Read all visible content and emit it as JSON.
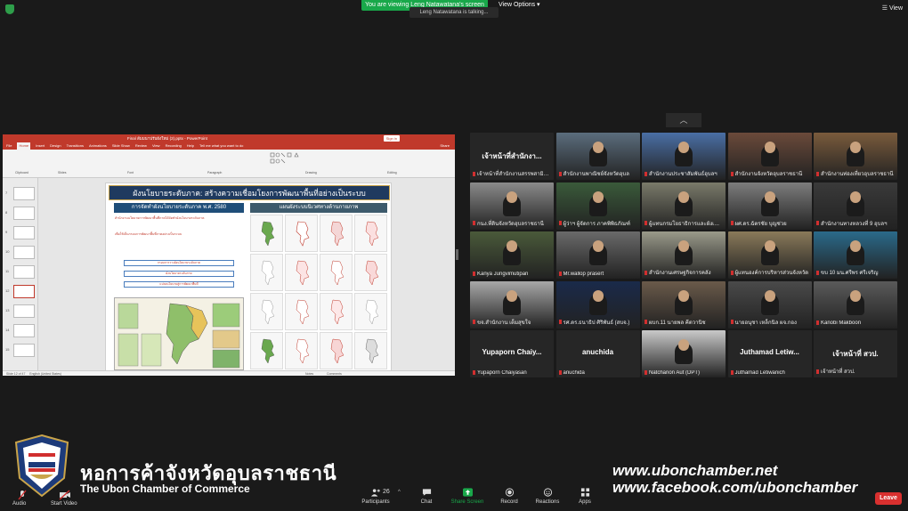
{
  "top": {
    "banner": "You are viewing Leng Natawatana's screen",
    "view_options": "View Options ▾",
    "talking": "Leng Natawatana is talking...",
    "view_button": "View"
  },
  "ppt": {
    "title": "Final สัมมนาปรับผังใหม่ (2).pptx - PowerPoint",
    "sign_in": "Sign in",
    "tabs": [
      "File",
      "Home",
      "Insert",
      "Design",
      "Transitions",
      "Animations",
      "Slide Show",
      "Review",
      "View",
      "Recording",
      "Help",
      "Tell me what you want to do"
    ],
    "share": "Share",
    "ribbon_groups": [
      "Clipboard",
      "Slides",
      "Font",
      "Paragraph",
      "Drawing",
      "Editing"
    ],
    "thumb_numbers": [
      "7",
      "8",
      "9",
      "10",
      "11",
      "12",
      "13",
      "14",
      "15"
    ],
    "status_left": "Slide 12 of 47",
    "status_lang": "English (United States)",
    "status_notes": "Notes",
    "status_comments": "Comments",
    "slide": {
      "title": "ผังนโยบายระดับภาค: สร้างความเชื่อมโยงการพัฒนาพื้นที่อย่างเป็นระบบ",
      "left_head": "การจัดทำผังนโยบายระดับภาค พ.ศ. 2580",
      "right_head": "แผนผังระบบนิเวศทางด้านกายภาพ",
      "bullet1": "สำนักงานนโยบายการพัฒนาพื้นที่ภาคได้จัดทำผังนโยบายระดับภาค",
      "bullet2": "เพื่อใช้เป็นกรอบการพัฒนาพื้นที่ภาคอย่างเป็นระบบ",
      "box1": "กรอบการวางผังนโยบายระดับภาค",
      "box2": "ผังนโยบายระดับภาค",
      "box3": "แปลงนโยบายสู่การพัฒนาพื้นที่"
    }
  },
  "gallery": [
    {
      "name": "เจ้าหน้าที่สำนักงา...",
      "label": "เจ้าหน้าที่สำนักงานสรรพสามิต...",
      "video": false
    },
    {
      "name": "",
      "label": "สำนักงานพาณิชย์จังหวัดอุบล",
      "video": true,
      "bg": "#5b6d7d"
    },
    {
      "name": "",
      "label": "สำนักงานประชาสัมพันธ์อุบลฯ",
      "video": true,
      "bg": "#4a6fa5"
    },
    {
      "name": "",
      "label": "สำนักงานจังหวัดอุบลราชธานี",
      "video": true,
      "bg": "#6b4a3a"
    },
    {
      "name": "",
      "label": "สำนักงานท่องเที่ยวอุบลราชธานี",
      "video": true,
      "bg": "#7a5b3c"
    },
    {
      "name": "",
      "label": "กนง.ที่ดินจังหวัดอุบลราชธานี",
      "video": true,
      "bg": "#8a8a8a"
    },
    {
      "name": "",
      "label": "ผู้ว่าฯ ผู้จัดการ ภาคพิพิธภัณฑ์",
      "video": true,
      "bg": "#3a5a3a"
    },
    {
      "name": "",
      "label": "ผู้แทนกรมโยธาธิการและผังเมือง",
      "video": true,
      "bg": "#7a7a6a"
    },
    {
      "name": "",
      "label": "ผศ.ดร.ฉัตรชัย บุญช่วย",
      "video": true,
      "bg": "#7d7d7d"
    },
    {
      "name": "",
      "label": "สำนักงานทางหลวงที่ 9 อุบลฯ",
      "video": true,
      "bg": "#3a3a3a"
    },
    {
      "name": "",
      "label": "Kanya Jungvimutipan",
      "video": true,
      "bg": "#4a5a3a"
    },
    {
      "name": "",
      "label": "Mr.wallop prasert",
      "video": true,
      "bg": "#6a6a6a"
    },
    {
      "name": "",
      "label": "สำนักงานเศรษฐกิจการคลัง",
      "video": true,
      "bg": "#9a9a8a"
    },
    {
      "name": "",
      "label": "ผู้แทนองค์การบริหารส่วนจังหวัด",
      "video": true,
      "bg": "#8a7a5a"
    },
    {
      "name": "",
      "label": "ขบ 10 มน.ศรีพร ศรีเจริญ",
      "video": true,
      "bg": "#2a6a8a"
    },
    {
      "name": "",
      "label": "ขจ.สำนักงาน เต็มสุขใจ",
      "video": true,
      "bg": "#a8a8a8"
    },
    {
      "name": "",
      "label": "รศ.ดร.ธนาธิป ศิริพันธ์ (สบจ.)",
      "video": true,
      "bg": "#1a2a4a"
    },
    {
      "name": "",
      "label": "ผบก.11 นายพล คีตวานิช",
      "video": true,
      "bg": "#6a5a4a"
    },
    {
      "name": "",
      "label": "นายอนุชา เหล็กนิล ผจ.กอง",
      "video": true,
      "bg": "#4a4a4a"
    },
    {
      "name": "",
      "label": "Kanobi Makboon",
      "video": true,
      "bg": "#5a5a5a"
    },
    {
      "name": "Yupaporn  Chaiy...",
      "label": "Yupaporn Chaiyasan",
      "video": false
    },
    {
      "name": "anuchida",
      "label": "anuchida",
      "video": false
    },
    {
      "name": "",
      "label": "Natchanon Aut (DPT)",
      "video": true,
      "bg": "#c9c9c9"
    },
    {
      "name": "Juthamad  Letiw...",
      "label": "Juthamad Letiwanich",
      "video": false
    },
    {
      "name": "เจ้าหน้าที่ สวป.",
      "label": "เจ้าหน้าที่ สวป.",
      "video": false
    }
  ],
  "bottom": {
    "chamber_thai": "หอการค้าจังหวัดอุบลราชธานี",
    "chamber_en": "The Ubon Chamber of Commerce",
    "url1": "www.ubonchamber.net",
    "url2": "www.facebook.com/ubonchamber",
    "audio": "Audio",
    "video": "Start Video",
    "participants": "Participants",
    "participants_count": "26",
    "chat": "Chat",
    "share_screen": "Share Screen",
    "record": "Record",
    "reactions": "Reactions",
    "apps": "Apps",
    "leave": "Leave"
  },
  "colors": {
    "share_green": "#19a84a",
    "leave_red": "#d9302f",
    "ppt_red": "#c0392b"
  }
}
